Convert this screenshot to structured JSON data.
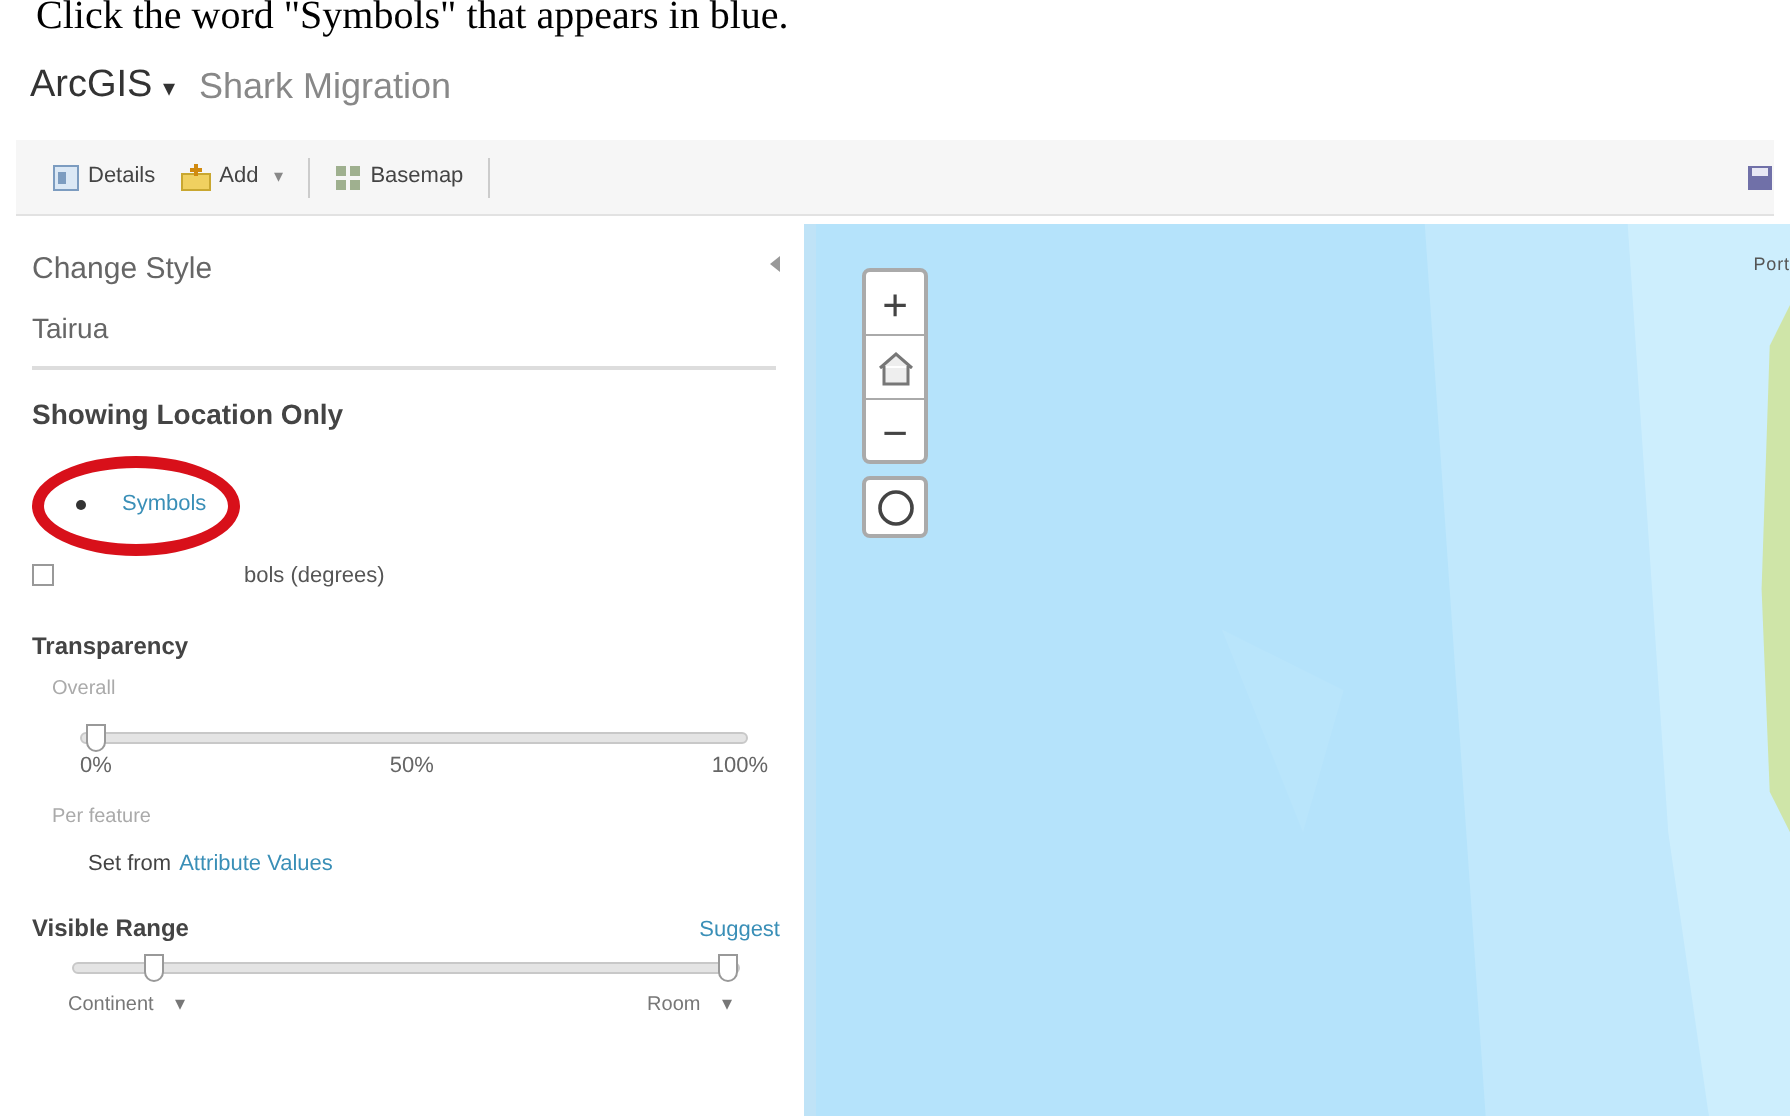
{
  "instruction": "Click the word \"Symbols\" that appears in blue.",
  "header": {
    "app": "ArcGIS",
    "caret": "▾",
    "title": "Shark Migration"
  },
  "toolbar": {
    "items": [
      {
        "kind": "details",
        "label": "Details"
      },
      {
        "kind": "add",
        "label": "Add",
        "caret": "▾"
      },
      {
        "kind": "basemap",
        "label": "Basemap"
      }
    ]
  },
  "panel": {
    "title": "Change Style",
    "layer": "Tairua",
    "section": "Showing Location Only",
    "symbols_link": "Symbols",
    "rotate": {
      "label": "bols (degrees)",
      "checked": false
    },
    "transparency": {
      "title": "Transparency",
      "overall": "Overall",
      "level": 0.02,
      "ticks": [
        "0%",
        "50%",
        "100%"
      ],
      "per_feature": "Per feature",
      "set_from": "Set from",
      "attribute_link": "Attribute Values"
    },
    "visible_range": {
      "title": "Visible Range",
      "suggest": "Suggest",
      "level": 0.12,
      "min_label": "Continent",
      "max_label": "Room",
      "caret": "▾"
    }
  },
  "map": {
    "zoom_in": "+",
    "zoom_out": "−",
    "place_label": "Port"
  }
}
